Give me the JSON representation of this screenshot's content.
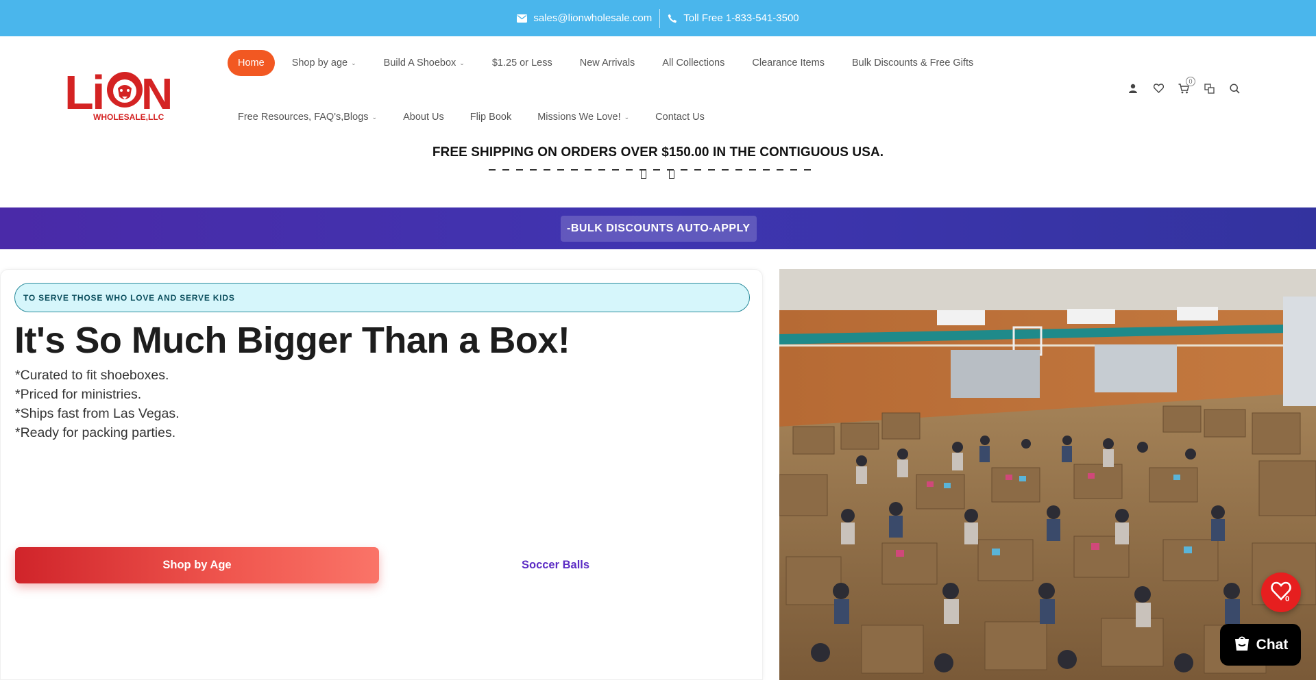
{
  "topbar": {
    "email": "sales@lionwholesale.com",
    "phone": "Toll Free 1-833-541-3500",
    "icons": [
      "mail-icon",
      "phone-icon"
    ]
  },
  "logo": {
    "text_main": "LiON",
    "text_sub": "WHOLESALE,LLC"
  },
  "nav": {
    "row1": [
      {
        "label": "Home",
        "active": true,
        "dropdown": false
      },
      {
        "label": "Shop by age",
        "dropdown": true
      },
      {
        "label": "Build A Shoebox",
        "dropdown": true
      },
      {
        "label": "$1.25 or Less",
        "dropdown": false
      },
      {
        "label": "New Arrivals",
        "dropdown": false
      },
      {
        "label": "All Collections",
        "dropdown": false
      },
      {
        "label": "Clearance Items",
        "dropdown": false
      },
      {
        "label": "Bulk Discounts & Free Gifts",
        "dropdown": false
      }
    ],
    "row2": [
      {
        "label": "Free Resources, FAQ's,Blogs",
        "dropdown": true
      },
      {
        "label": "About Us",
        "dropdown": false
      },
      {
        "label": "Flip Book",
        "dropdown": false
      },
      {
        "label": "Missions We Love!",
        "dropdown": true
      },
      {
        "label": "Contact Us",
        "dropdown": false
      }
    ],
    "chevron": "⌄"
  },
  "header_icons": {
    "cart_count": "0",
    "icons": [
      "account-icon",
      "wishlist-icon",
      "cart-icon",
      "compare-icon",
      "search-icon"
    ]
  },
  "shipping_banner": "FREE SHIPPING ON ORDERS OVER $150.00 IN THE CONTIGUOUS USA.",
  "band": {
    "label": "-BULK DISCOUNTS AUTO-APPLY",
    "color": "#4a2aa8"
  },
  "hero": {
    "tagline": "TO SERVE THOSE WHO LOVE AND SERVE KIDS",
    "title": "It's So Much Bigger Than a Box!",
    "bullets": [
      "*Curated to fit shoeboxes.",
      "*Priced for ministries.",
      "*Ships fast from Las Vegas.",
      "*Ready for packing parties."
    ],
    "primary_button": "Shop by Age",
    "secondary_link": "Soccer Balls"
  },
  "floating": {
    "wishlist_count": "0",
    "chat_label": "Chat"
  },
  "colors": {
    "topbar": "#4ab6ec",
    "accent_orange": "#f25822",
    "primary_red": "#d0242a",
    "link_purple": "#5b2bc4",
    "tagline_bg": "#d6f6fb"
  }
}
